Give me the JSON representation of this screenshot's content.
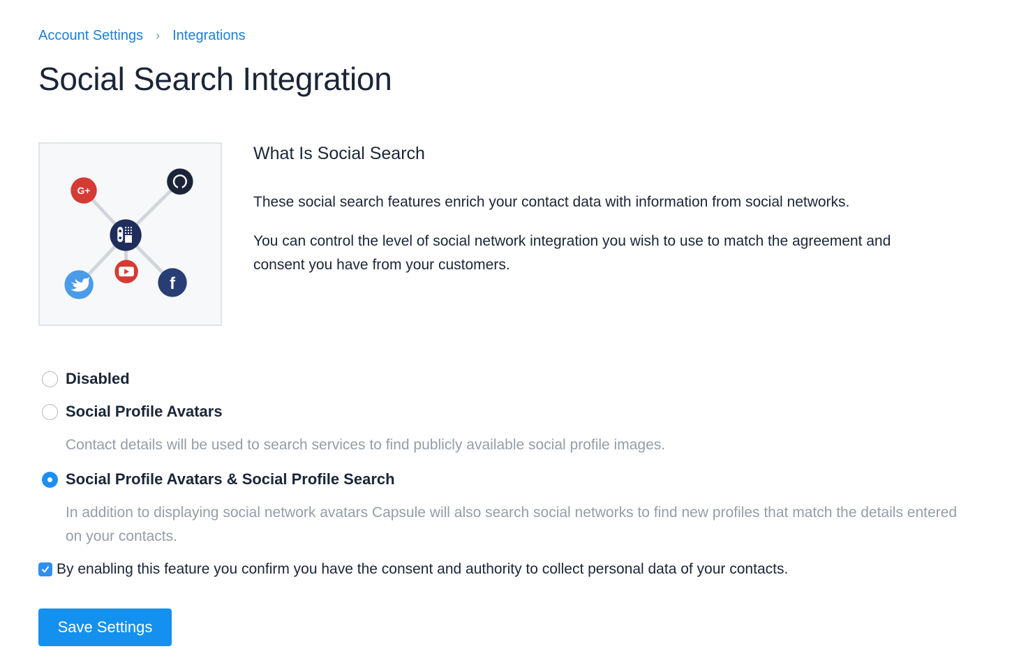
{
  "breadcrumb": {
    "items": [
      "Account Settings",
      "Integrations"
    ],
    "separator": "›"
  },
  "page": {
    "title": "Social Search Integration"
  },
  "illustration": {
    "icons": [
      "google-plus",
      "github",
      "hub",
      "twitter",
      "youtube",
      "facebook"
    ],
    "colors": {
      "google_plus": "#d43b34",
      "github": "#1b2438",
      "hub": "#1f2d5c",
      "twitter": "#4a9be8",
      "youtube": "#d43b34",
      "facebook": "#283d73"
    }
  },
  "info": {
    "heading": "What Is Social Search",
    "paragraph1": "These social search features enrich your contact data with information from social networks.",
    "paragraph2": "You can control the level of social network integration you wish to use to match the agreement and consent you have from your customers."
  },
  "options": [
    {
      "label": "Disabled",
      "description": "",
      "selected": false
    },
    {
      "label": "Social Profile Avatars",
      "description": "Contact details will be used to search services to find publicly available social profile images.",
      "selected": false
    },
    {
      "label": "Social Profile Avatars & Social Profile Search",
      "description": "In addition to displaying social network avatars Capsule will also search social networks to find new profiles that match the details entered on your contacts.",
      "selected": true
    }
  ],
  "consent": {
    "label": "By enabling this feature you confirm you have the consent and authority to collect personal data of your contacts.",
    "checked": true
  },
  "actions": {
    "save_label": "Save Settings"
  },
  "colors": {
    "link": "#1c7fd6",
    "primary": "#1490ee",
    "text": "#1b2536",
    "muted": "#959da8"
  }
}
